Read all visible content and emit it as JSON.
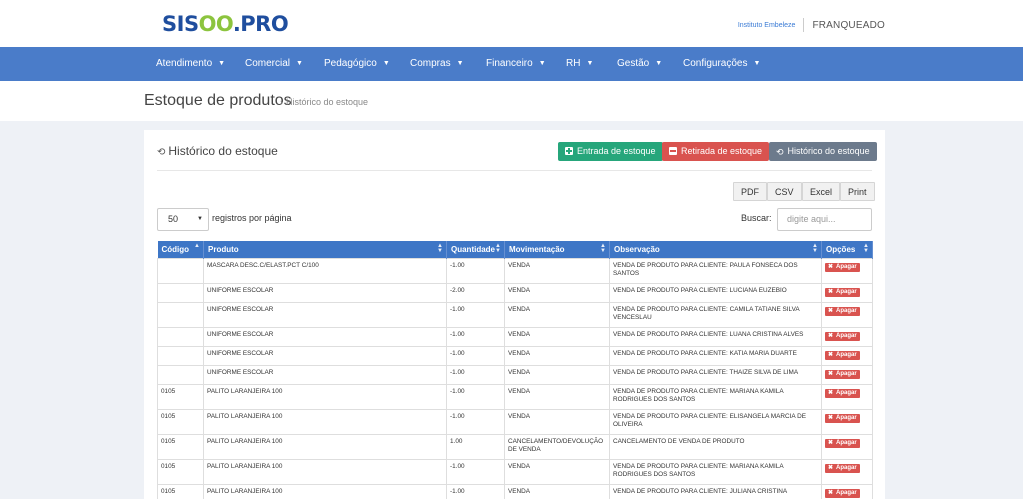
{
  "header": {
    "logo_part1": "SIS",
    "logo_part2": "OO",
    "logo_part3": ".PRO",
    "institute": "Instituto Embeleze",
    "role": "FRANQUEADO"
  },
  "nav": {
    "items": [
      {
        "label": "Atendimento"
      },
      {
        "label": "Comercial"
      },
      {
        "label": "Pedagógico"
      },
      {
        "label": "Compras"
      },
      {
        "label": "Financeiro"
      },
      {
        "label": "RH"
      },
      {
        "label": "Gestão"
      },
      {
        "label": "Configurações"
      }
    ],
    "caret_icon": "caret-down-icon"
  },
  "page": {
    "title": "Estoque de produtos",
    "breadcrumb": "Histórico do estoque"
  },
  "panel": {
    "title": "Histórico do estoque",
    "buttons": {
      "entrada": "Entrada de estoque",
      "retirada": "Retirada de estoque",
      "historico": "Histórico do estoque"
    },
    "export": {
      "pdf": "PDF",
      "csv": "CSV",
      "excel": "Excel",
      "print": "Print"
    },
    "page_size": "50",
    "per_page_label": "registros por página",
    "search_label": "Buscar:",
    "search_placeholder": "digite aqui..."
  },
  "table": {
    "columns": [
      "Código",
      "Produto",
      "Quantidade",
      "Movimentação",
      "Observação",
      "Opções"
    ],
    "delete_label": "Apagar",
    "rows": [
      {
        "codigo": "",
        "produto": "MASCARA DESC.C/ELAST.PCT C/100",
        "quantidade": "-1.00",
        "movimentacao": "VENDA",
        "observacao": "VENDA DE PRODUTO PARA CLIENTE: PAULA FONSECA DOS SANTOS"
      },
      {
        "codigo": "",
        "produto": "UNIFORME ESCOLAR",
        "quantidade": "-2.00",
        "movimentacao": "VENDA",
        "observacao": "VENDA DE PRODUTO PARA CLIENTE: LUCIANA EUZEBIO"
      },
      {
        "codigo": "",
        "produto": "UNIFORME ESCOLAR",
        "quantidade": "-1.00",
        "movimentacao": "VENDA",
        "observacao": "VENDA DE PRODUTO PARA CLIENTE: CAMILA TATIANE SILVA VENCESLAU"
      },
      {
        "codigo": "",
        "produto": "UNIFORME ESCOLAR",
        "quantidade": "-1.00",
        "movimentacao": "VENDA",
        "observacao": "VENDA DE PRODUTO PARA CLIENTE: LUANA CRISTINA ALVES"
      },
      {
        "codigo": "",
        "produto": "UNIFORME ESCOLAR",
        "quantidade": "-1.00",
        "movimentacao": "VENDA",
        "observacao": "VENDA DE PRODUTO PARA CLIENTE: KATIA MARIA DUARTE"
      },
      {
        "codigo": "",
        "produto": "UNIFORME ESCOLAR",
        "quantidade": "-1.00",
        "movimentacao": "VENDA",
        "observacao": "VENDA DE PRODUTO PARA CLIENTE: THAIZE SILVA DE LIMA"
      },
      {
        "codigo": "0105",
        "produto": "PALITO LARANJEIRA 100",
        "quantidade": "-1.00",
        "movimentacao": "VENDA",
        "observacao": "VENDA DE PRODUTO PARA CLIENTE: MARIANA KAMILA RODRIGUES DOS SANTOS"
      },
      {
        "codigo": "0105",
        "produto": "PALITO LARANJEIRA 100",
        "quantidade": "-1.00",
        "movimentacao": "VENDA",
        "observacao": "VENDA DE PRODUTO PARA CLIENTE: ELISANGELA MARCIA DE OLIVEIRA"
      },
      {
        "codigo": "0105",
        "produto": "PALITO LARANJEIRA 100",
        "quantidade": "1.00",
        "movimentacao": "CANCELAMENTO/DEVOLUÇÃO DE VENDA",
        "observacao": "CANCELAMENTO DE VENDA DE PRODUTO"
      },
      {
        "codigo": "0105",
        "produto": "PALITO LARANJEIRA 100",
        "quantidade": "-1.00",
        "movimentacao": "VENDA",
        "observacao": "VENDA DE PRODUTO PARA CLIENTE: MARIANA KAMILA RODRIGUES DOS SANTOS"
      },
      {
        "codigo": "0105",
        "produto": "PALITO LARANJEIRA 100",
        "quantidade": "-1.00",
        "movimentacao": "VENDA",
        "observacao": "VENDA DE PRODUTO PARA CLIENTE: JULIANA CRISTINA"
      }
    ]
  },
  "colors": {
    "nav": "#4a7cc9",
    "table_header": "#3e76c6",
    "green": "#26a67b",
    "red": "#d9534f",
    "grey": "#6c7a8c"
  }
}
